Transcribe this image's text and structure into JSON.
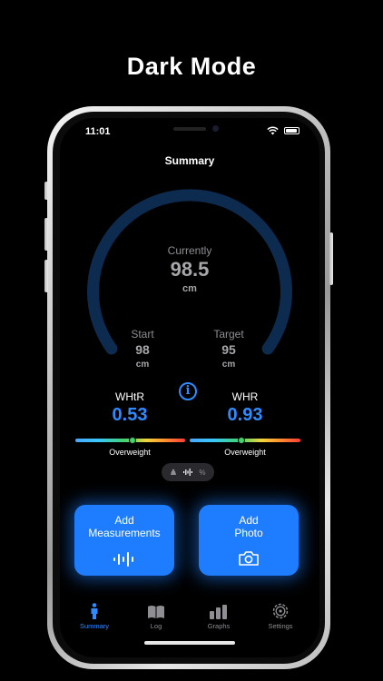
{
  "headline": "Dark Mode",
  "status": {
    "time": "11:01"
  },
  "nav": {
    "title": "Summary"
  },
  "gauge": {
    "current_label": "Currently",
    "current_value": "98.5",
    "current_unit": "cm",
    "start_label": "Start",
    "start_value": "98",
    "start_unit": "cm",
    "target_label": "Target",
    "target_value": "95",
    "target_unit": "cm",
    "progress_fraction": 0.0,
    "track_color": "#0d2a4f"
  },
  "ratios": {
    "whtr": {
      "label": "WHtR",
      "value": "0.53",
      "category": "Overweight"
    },
    "whr": {
      "label": "WHR",
      "value": "0.93",
      "category": "Overweight"
    }
  },
  "segment": {
    "options": [
      "scale-icon",
      "waveform-icon",
      "percent-icon"
    ],
    "percent_glyph": "%",
    "selected": "waveform-icon"
  },
  "cards": {
    "measurements": {
      "line1": "Add",
      "line2": "Measurements",
      "icon": "waveform-icon"
    },
    "photo": {
      "line1": "Add",
      "line2": "Photo",
      "icon": "camera-icon"
    }
  },
  "tabs": [
    {
      "label": "Summary",
      "icon": "person-icon",
      "active": true
    },
    {
      "label": "Log",
      "icon": "book-icon",
      "active": false
    },
    {
      "label": "Graphs",
      "icon": "bar-chart-icon",
      "active": false
    },
    {
      "label": "Settings",
      "icon": "gear-icon",
      "active": false
    }
  ],
  "colors": {
    "accent": "#2f8bff",
    "card": "#1e7dff",
    "background": "#000000"
  }
}
